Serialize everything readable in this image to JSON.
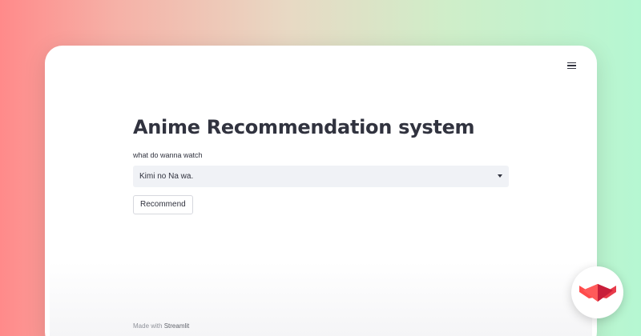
{
  "app": {
    "title": "Anime Recommendation system",
    "menu_icon": "hamburger-menu-icon"
  },
  "input": {
    "label": "what do wanna watch",
    "selected_value": "Kimi no Na wa."
  },
  "actions": {
    "recommend_label": "Recommend"
  },
  "footer": {
    "prefix": "Made with",
    "brand": "Streamlit"
  },
  "colors": {
    "text": "#31333f",
    "select_bg": "#f0f2f6",
    "logo_red": "#ff4b4b"
  }
}
